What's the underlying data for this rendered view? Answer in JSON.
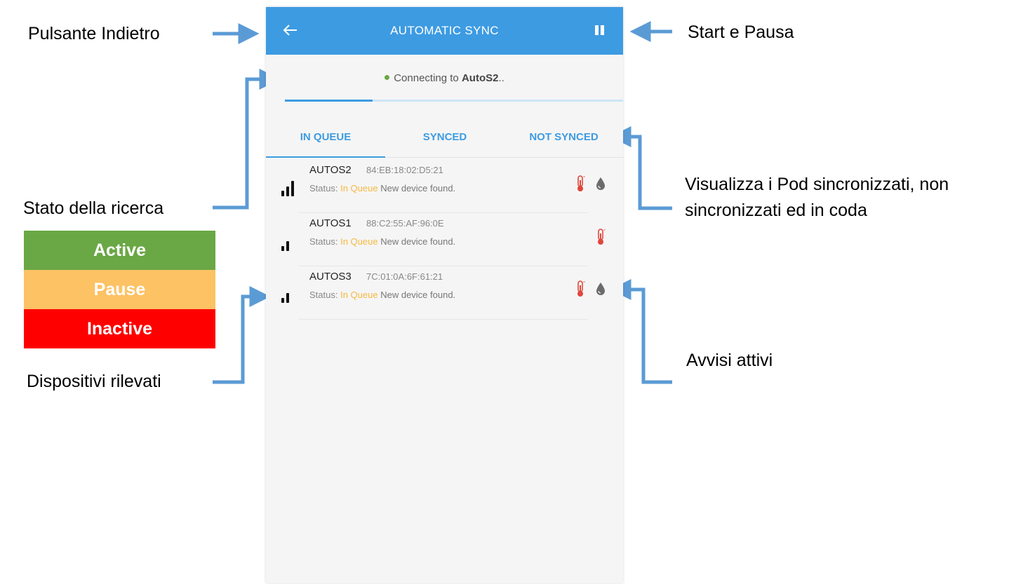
{
  "callouts": {
    "back": "Pulsante Indietro",
    "start_pause": "Start e Pausa",
    "search_state": "Stato della ricerca",
    "view_pods_line1": "Visualizza i Pod sincronizzati, non",
    "view_pods_line2": "sincronizzati ed in coda",
    "alerts": "Avvisi attivi",
    "devices": "Dispositivi rilevati"
  },
  "legend": [
    {
      "label": "Active",
      "color": "#6aa745"
    },
    {
      "label": "Pause",
      "color": "#fcc264"
    },
    {
      "label": "Inactive",
      "color": "#ff0000"
    }
  ],
  "app": {
    "title": "AUTOMATIC SYNC",
    "status_prefix": "Connecting to",
    "status_device": "AutoS2",
    "status_suffix": "..",
    "sync_progress_pct": 26,
    "tabs": [
      "IN QUEUE",
      "SYNCED",
      "NOT SYNCED"
    ],
    "active_tab": "IN QUEUE",
    "devices": [
      {
        "name": "AUTOS2",
        "mac": "84:EB:18:02:D5:21",
        "status_label": "Status:",
        "status": "In Queue",
        "message": "New device found.",
        "signal_bars": 3,
        "alerts": [
          "thermometer-icon",
          "water-drop-icon"
        ]
      },
      {
        "name": "AUTOS1",
        "mac": "88:C2:55:AF:96:0E",
        "status_label": "Status:",
        "status": "In Queue",
        "message": "New device found.",
        "signal_bars": 2,
        "alerts": [
          "thermometer-icon"
        ]
      },
      {
        "name": "AUTOS3",
        "mac": "7C:01:0A:6F:61:21",
        "status_label": "Status:",
        "status": "In Queue",
        "message": "New device found.",
        "signal_bars": 2,
        "alerts": [
          "thermometer-icon",
          "water-drop-icon"
        ]
      }
    ],
    "colors": {
      "appbar": "#3d9be2",
      "queue_status": "#f5b942",
      "connected_dot": "#6aa745",
      "alert_temp": "#e0463b"
    }
  }
}
